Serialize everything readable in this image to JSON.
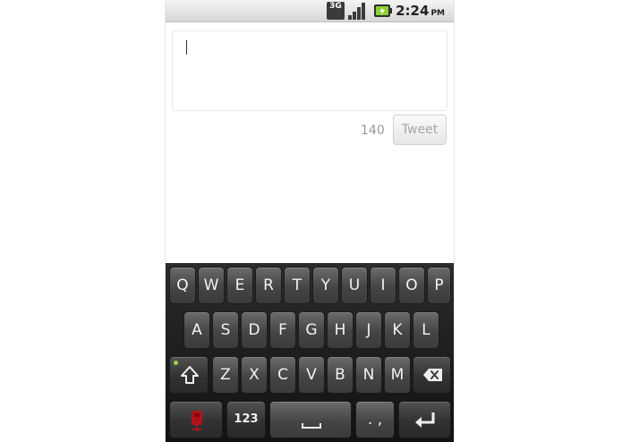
{
  "status_bar": {
    "network_label": "3G",
    "time": "2:24",
    "ampm": "PM",
    "icons": [
      "network-3g-icon",
      "signal-strength-icon",
      "battery-icon"
    ]
  },
  "compose": {
    "text": "",
    "char_count": "140",
    "tweet_label": "Tweet"
  },
  "keyboard": {
    "row1": [
      "Q",
      "W",
      "E",
      "R",
      "T",
      "Y",
      "U",
      "I",
      "O",
      "P"
    ],
    "row2": [
      "A",
      "S",
      "D",
      "F",
      "G",
      "H",
      "J",
      "K",
      "L"
    ],
    "row3": [
      "Z",
      "X",
      "C",
      "V",
      "B",
      "N",
      "M"
    ],
    "numbers_label": "123",
    "punct_label": ". ,"
  },
  "colors": {
    "keyboard_bg": "#1c1c1c",
    "key_top": "#6b6b6b",
    "caps_indicator": "#9bd64a",
    "mic_red": "#b3121a"
  }
}
